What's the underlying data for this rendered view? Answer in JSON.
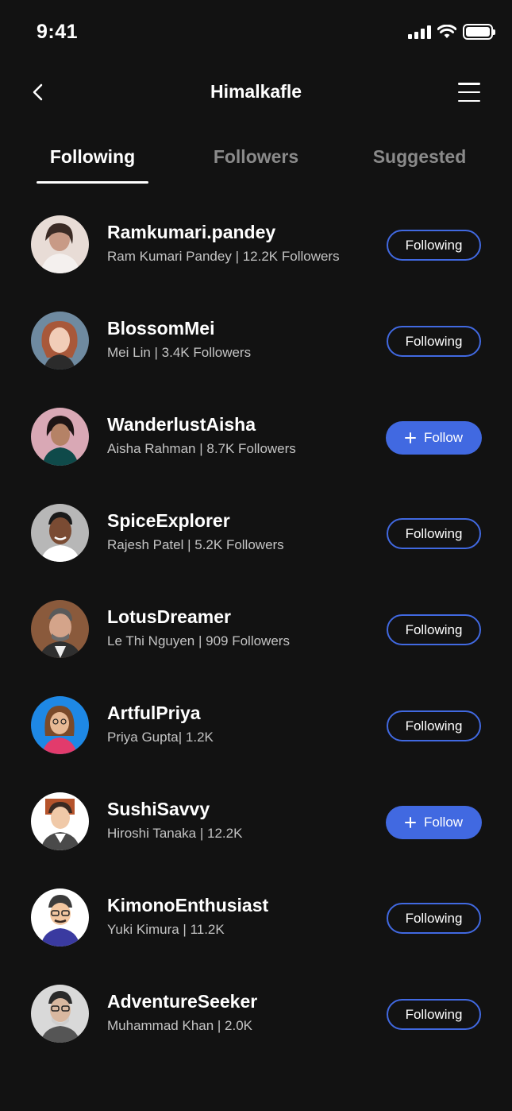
{
  "status_bar": {
    "time": "9:41"
  },
  "header": {
    "title": "Himalkafle"
  },
  "tabs": [
    {
      "label": "Following",
      "active": true
    },
    {
      "label": "Followers",
      "active": false
    },
    {
      "label": "Suggested",
      "active": false
    }
  ],
  "accent_color": "#4169e1",
  "users": [
    {
      "username": "Ramkumari.pandey",
      "subtitle": "Ram Kumari Pandey | 12.2K Followers",
      "action": "Following",
      "avatar_bg": "#e8dcd6"
    },
    {
      "username": "BlossomMei",
      "subtitle": "Mei Lin | 3.4K Followers",
      "action": "Following",
      "avatar_bg": "#6f8aa0"
    },
    {
      "username": "WanderlustAisha",
      "subtitle": "Aisha Rahman | 8.7K Followers",
      "action": "Follow",
      "avatar_bg": "#d9a8b5"
    },
    {
      "username": "SpiceExplorer",
      "subtitle": "Rajesh Patel | 5.2K Followers",
      "action": "Following",
      "avatar_bg": "#b7b7b7"
    },
    {
      "username": "LotusDreamer",
      "subtitle": "Le Thi Nguyen | 909 Followers",
      "action": "Following",
      "avatar_bg": "#8a5a3c"
    },
    {
      "username": "ArtfulPriya",
      "subtitle": "Priya Gupta| 1.2K",
      "action": "Following",
      "avatar_bg": "#1e88e5"
    },
    {
      "username": "SushiSavvy",
      "subtitle": "Hiroshi Tanaka | 12.2K",
      "action": "Follow",
      "avatar_bg": "#ffffff"
    },
    {
      "username": "KimonoEnthusiast",
      "subtitle": "Yuki Kimura | 11.2K",
      "action": "Following",
      "avatar_bg": "#ffffff"
    },
    {
      "username": "AdventureSeeker",
      "subtitle": "Muhammad Khan | 2.0K",
      "action": "Following",
      "avatar_bg": "#d9d9d9"
    }
  ]
}
